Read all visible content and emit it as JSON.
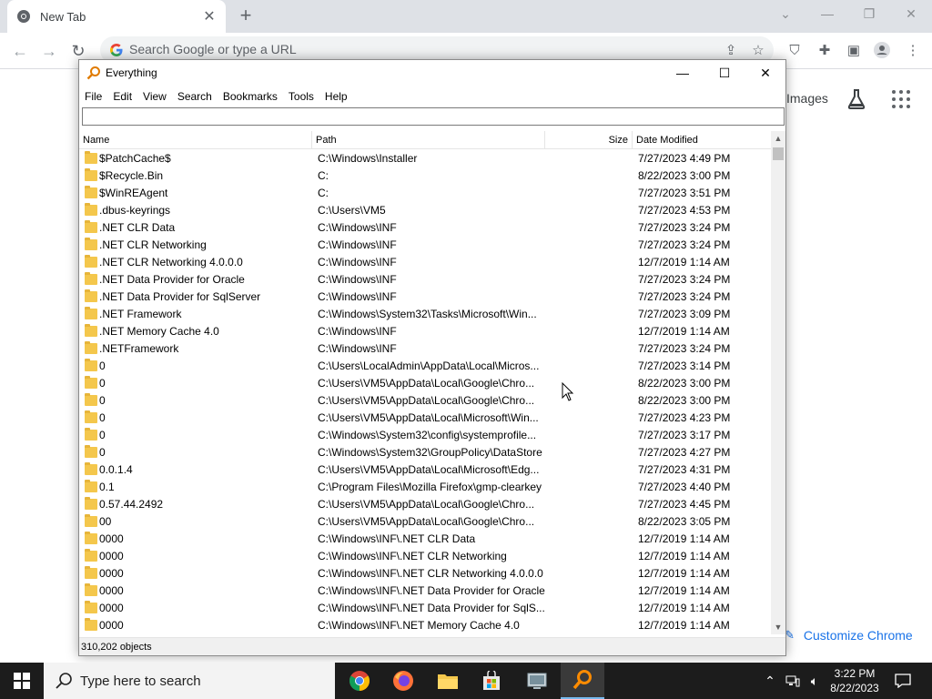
{
  "chrome": {
    "tab_title": "New Tab",
    "omnibox_placeholder": "Search Google or type a URL",
    "images_label": "Images",
    "customize_label": "Customize Chrome"
  },
  "everything": {
    "title": "Everything",
    "menu": [
      "File",
      "Edit",
      "View",
      "Search",
      "Bookmarks",
      "Tools",
      "Help"
    ],
    "search_value": "",
    "columns": {
      "name": "Name",
      "path": "Path",
      "size": "Size",
      "date": "Date Modified"
    },
    "rows": [
      {
        "name": "$PatchCache$",
        "path": "C:\\Windows\\Installer",
        "date": "7/27/2023 4:49 PM"
      },
      {
        "name": "$Recycle.Bin",
        "path": "C:",
        "date": "8/22/2023 3:00 PM"
      },
      {
        "name": "$WinREAgent",
        "path": "C:",
        "date": "7/27/2023 3:51 PM"
      },
      {
        "name": ".dbus-keyrings",
        "path": "C:\\Users\\VM5",
        "date": "7/27/2023 4:53 PM"
      },
      {
        "name": ".NET CLR Data",
        "path": "C:\\Windows\\INF",
        "date": "7/27/2023 3:24 PM"
      },
      {
        "name": ".NET CLR Networking",
        "path": "C:\\Windows\\INF",
        "date": "7/27/2023 3:24 PM"
      },
      {
        "name": ".NET CLR Networking 4.0.0.0",
        "path": "C:\\Windows\\INF",
        "date": "12/7/2019 1:14 AM"
      },
      {
        "name": ".NET Data Provider for Oracle",
        "path": "C:\\Windows\\INF",
        "date": "7/27/2023 3:24 PM"
      },
      {
        "name": ".NET Data Provider for SqlServer",
        "path": "C:\\Windows\\INF",
        "date": "7/27/2023 3:24 PM"
      },
      {
        "name": ".NET Framework",
        "path": "C:\\Windows\\System32\\Tasks\\Microsoft\\Win...",
        "date": "7/27/2023 3:09 PM"
      },
      {
        "name": ".NET Memory Cache 4.0",
        "path": "C:\\Windows\\INF",
        "date": "12/7/2019 1:14 AM"
      },
      {
        "name": ".NETFramework",
        "path": "C:\\Windows\\INF",
        "date": "7/27/2023 3:24 PM"
      },
      {
        "name": "0",
        "path": "C:\\Users\\LocalAdmin\\AppData\\Local\\Micros...",
        "date": "7/27/2023 3:14 PM"
      },
      {
        "name": "0",
        "path": "C:\\Users\\VM5\\AppData\\Local\\Google\\Chro...",
        "date": "8/22/2023 3:00 PM"
      },
      {
        "name": "0",
        "path": "C:\\Users\\VM5\\AppData\\Local\\Google\\Chro...",
        "date": "8/22/2023 3:00 PM"
      },
      {
        "name": "0",
        "path": "C:\\Users\\VM5\\AppData\\Local\\Microsoft\\Win...",
        "date": "7/27/2023 4:23 PM"
      },
      {
        "name": "0",
        "path": "C:\\Windows\\System32\\config\\systemprofile...",
        "date": "7/27/2023 3:17 PM"
      },
      {
        "name": "0",
        "path": "C:\\Windows\\System32\\GroupPolicy\\DataStore",
        "date": "7/27/2023 4:27 PM"
      },
      {
        "name": "0.0.1.4",
        "path": "C:\\Users\\VM5\\AppData\\Local\\Microsoft\\Edg...",
        "date": "7/27/2023 4:31 PM"
      },
      {
        "name": "0.1",
        "path": "C:\\Program Files\\Mozilla Firefox\\gmp-clearkey",
        "date": "7/27/2023 4:40 PM"
      },
      {
        "name": "0.57.44.2492",
        "path": "C:\\Users\\VM5\\AppData\\Local\\Google\\Chro...",
        "date": "7/27/2023 4:45 PM"
      },
      {
        "name": "00",
        "path": "C:\\Users\\VM5\\AppData\\Local\\Google\\Chro...",
        "date": "8/22/2023 3:05 PM"
      },
      {
        "name": "0000",
        "path": "C:\\Windows\\INF\\.NET CLR Data",
        "date": "12/7/2019 1:14 AM"
      },
      {
        "name": "0000",
        "path": "C:\\Windows\\INF\\.NET CLR Networking",
        "date": "12/7/2019 1:14 AM"
      },
      {
        "name": "0000",
        "path": "C:\\Windows\\INF\\.NET CLR Networking 4.0.0.0",
        "date": "12/7/2019 1:14 AM"
      },
      {
        "name": "0000",
        "path": "C:\\Windows\\INF\\.NET Data Provider for Oracle",
        "date": "12/7/2019 1:14 AM"
      },
      {
        "name": "0000",
        "path": "C:\\Windows\\INF\\.NET Data Provider for SqlS...",
        "date": "12/7/2019 1:14 AM"
      },
      {
        "name": "0000",
        "path": "C:\\Windows\\INF\\.NET Memory Cache 4.0",
        "date": "12/7/2019 1:14 AM"
      }
    ],
    "status": "310,202 objects"
  },
  "taskbar": {
    "search_placeholder": "Type here to search",
    "time": "3:22 PM",
    "date": "8/22/2023",
    "apps": [
      "chrome-icon",
      "firefox-icon",
      "file-explorer-icon",
      "microsoft-store-icon",
      "control-panel-icon",
      "everything-icon"
    ]
  },
  "colors": {
    "chrome_frame": "#dee1e6",
    "taskbar": "#1c1c1c",
    "folder": "#f4c74c",
    "accent_blue": "#1a73e8"
  }
}
